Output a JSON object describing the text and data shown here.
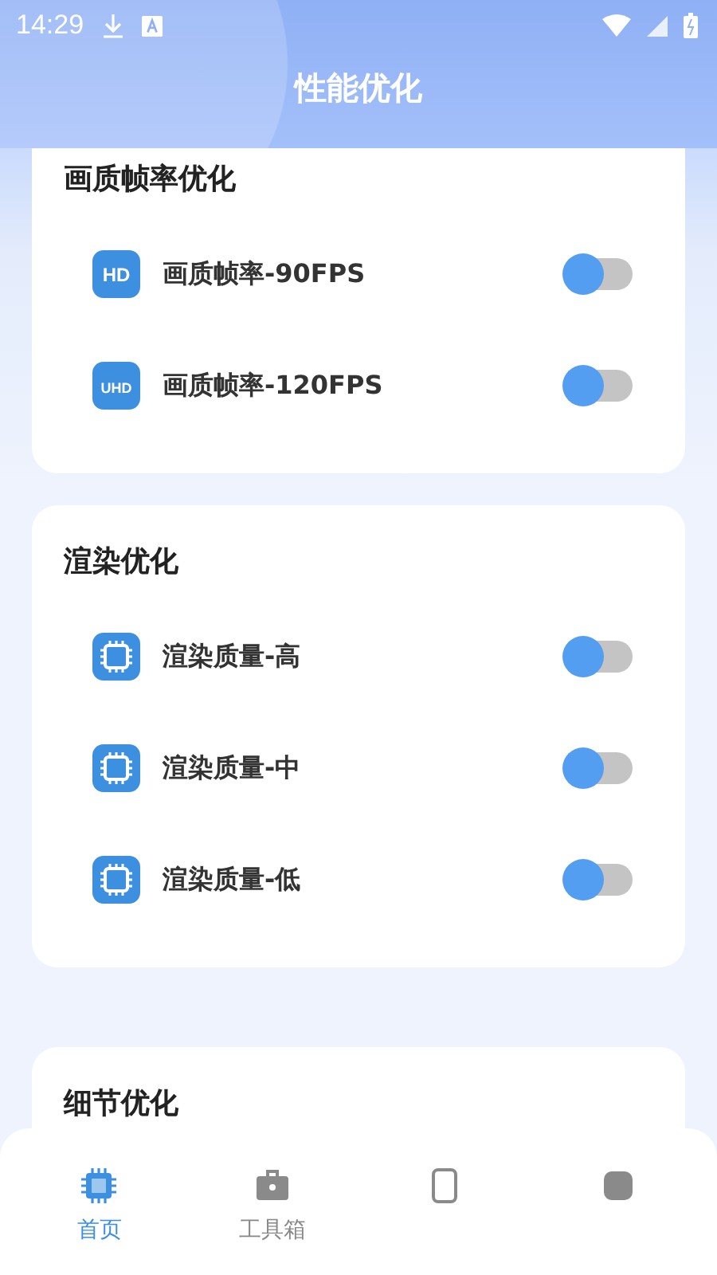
{
  "status_bar": {
    "time": "14:29"
  },
  "header": {
    "title": "性能优化"
  },
  "sections": [
    {
      "title": "画质帧率优化",
      "items": [
        {
          "icon": "HD",
          "label": "画质帧率-90FPS",
          "checked": false
        },
        {
          "icon": "UHD",
          "label": "画质帧率-120FPS",
          "checked": false
        }
      ]
    },
    {
      "title": "渲染优化",
      "items": [
        {
          "kind": "chip",
          "label": "渲染质量-高",
          "checked": false
        },
        {
          "kind": "chip",
          "label": "渲染质量-中",
          "checked": false
        },
        {
          "kind": "chip",
          "label": "渲染质量-低",
          "checked": false
        }
      ]
    },
    {
      "title": "细节优化"
    }
  ],
  "tabs": [
    {
      "kind": "chip",
      "label": "首页",
      "selected": true
    },
    {
      "kind": "toolbox",
      "label": "工具箱",
      "selected": false
    },
    {
      "kind": "phone",
      "selected": false
    },
    {
      "kind": "other",
      "selected": false
    }
  ]
}
